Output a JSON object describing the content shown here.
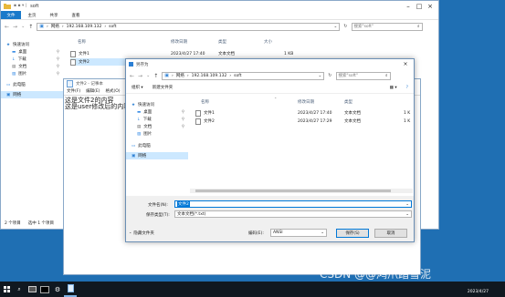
{
  "explorer": {
    "title": "soft",
    "tabs": [
      "文件",
      "主页",
      "共享",
      "查看"
    ],
    "path": [
      "网络",
      "192.168.109.132",
      "soft"
    ],
    "search_placeholder": "搜索\"soft\"",
    "columns": [
      "名称",
      "修改日期",
      "类型",
      "大小"
    ],
    "files": [
      {
        "name": "文件1",
        "date": "2023/4/27 17:40",
        "type": "文本文档",
        "size": "1 KB"
      },
      {
        "name": "文件2",
        "date": "",
        "type": "",
        "size": ""
      }
    ],
    "nav": {
      "quick_access": "快速访问",
      "items": [
        "桌面",
        "下载",
        "文档",
        "图片"
      ],
      "this_pc": "此电脑",
      "network": "网络"
    },
    "status": {
      "count": "2 个项目",
      "selected": "选中 1 个项目"
    }
  },
  "notepad": {
    "title": "文件2 - 记事本",
    "menu": [
      "文件(F)",
      "编辑(E)",
      "格式(O)"
    ],
    "line1": "这是文件2的内容",
    "line2": "这是user修改后的内容"
  },
  "dialog": {
    "title": "另存为",
    "path": [
      "网络",
      "192.168.109.132",
      "soft"
    ],
    "search_placeholder": "搜索\"soft\"",
    "organize": "组织 ▾",
    "new_folder": "新建文件夹",
    "columns": [
      "名称",
      "修改日期",
      "类型"
    ],
    "files": [
      {
        "name": "文件1",
        "date": "2023/4/27 17:40",
        "type": "文本文档",
        "size": "1 K"
      },
      {
        "name": "文件2",
        "date": "2023/4/27 17:29",
        "type": "文本文档",
        "size": "1 K"
      }
    ],
    "nav": {
      "quick_access": "快速访问",
      "items": [
        "桌面",
        "下载",
        "文档",
        "图片"
      ],
      "this_pc": "此电脑",
      "network": "网络"
    },
    "filename_label": "文件名(N):",
    "filename_value": "文件2",
    "filetype_label": "保存类型(T):",
    "filetype_value": "文本文档(*.txt)",
    "hide_folders": "隐藏文件夹",
    "encoding_label": "编码(E):",
    "encoding_value": "ANSI",
    "save": "保存(S)",
    "cancel": "取消"
  },
  "taskbar": {
    "date": "2023/4/27",
    "watermark": "CSDN @@鸿爪踏雪泥"
  },
  "colors": {
    "accent": "#0078d7",
    "selection": "#cce8ff",
    "desktop": "#1f6fb3"
  }
}
